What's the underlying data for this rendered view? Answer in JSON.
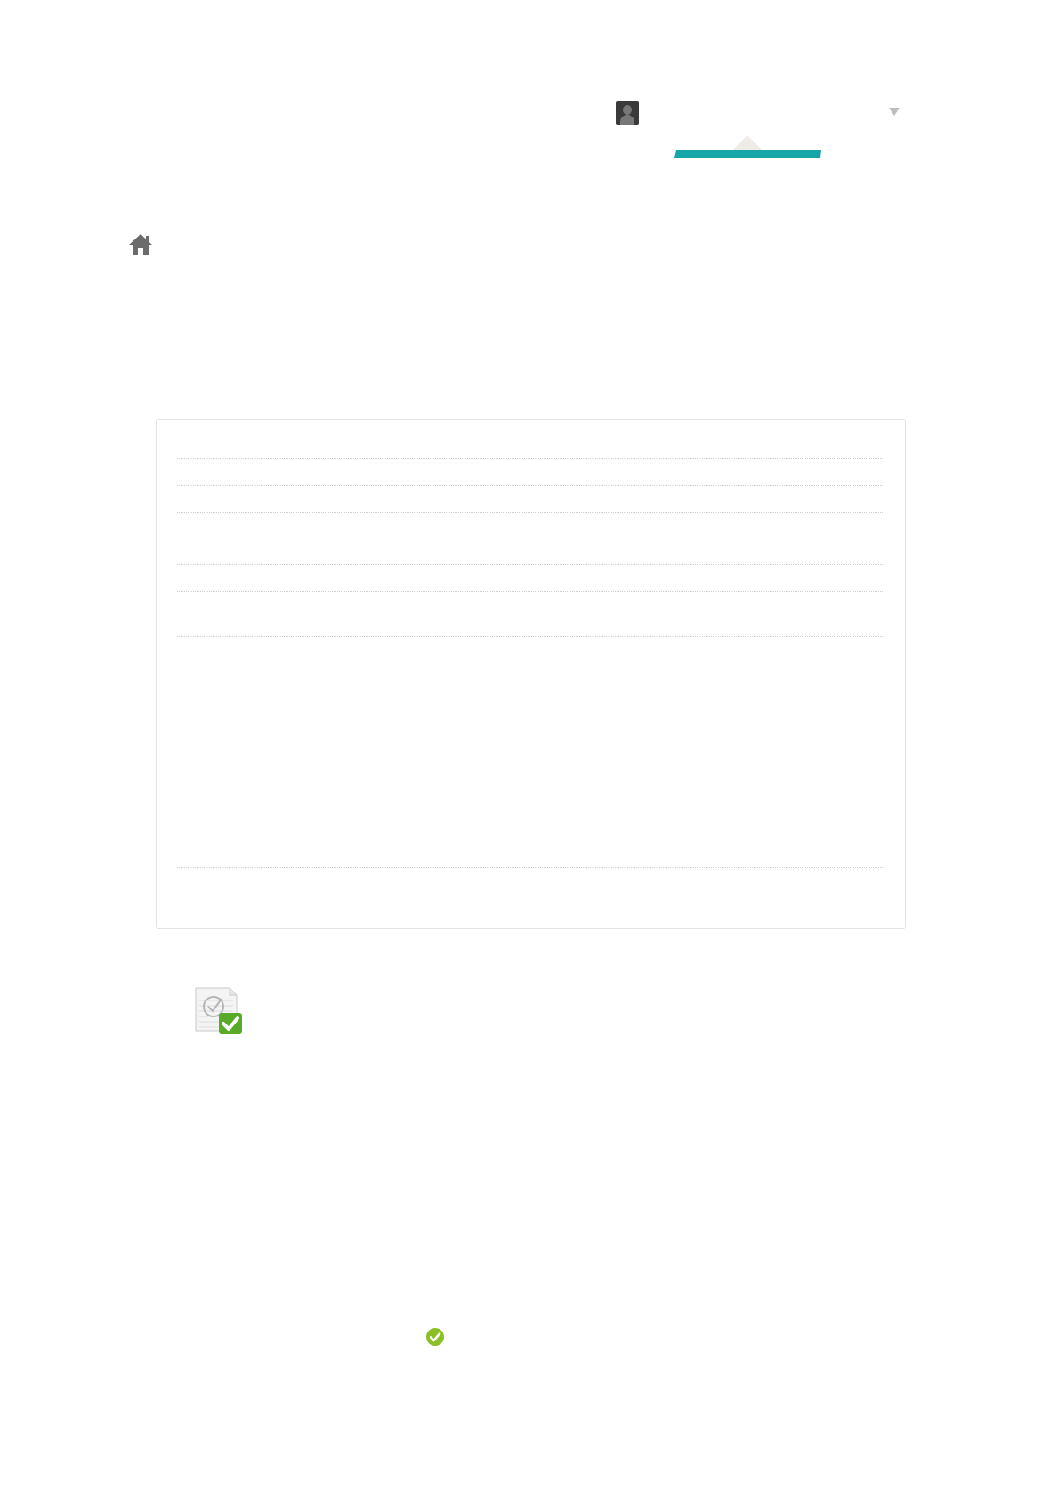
{
  "header": {
    "avatar_icon": "user-avatar-icon",
    "menu_toggle_icon": "chevron-down-icon",
    "active_tab_color": "#17a6a8"
  },
  "breadcrumb": {
    "home_icon": "home-icon"
  },
  "details_panel": {
    "row_count": 10
  },
  "completion": {
    "document_icon": "document-check-icon",
    "status_icon": "check-circle-icon",
    "status_color": "#8cbf26"
  }
}
